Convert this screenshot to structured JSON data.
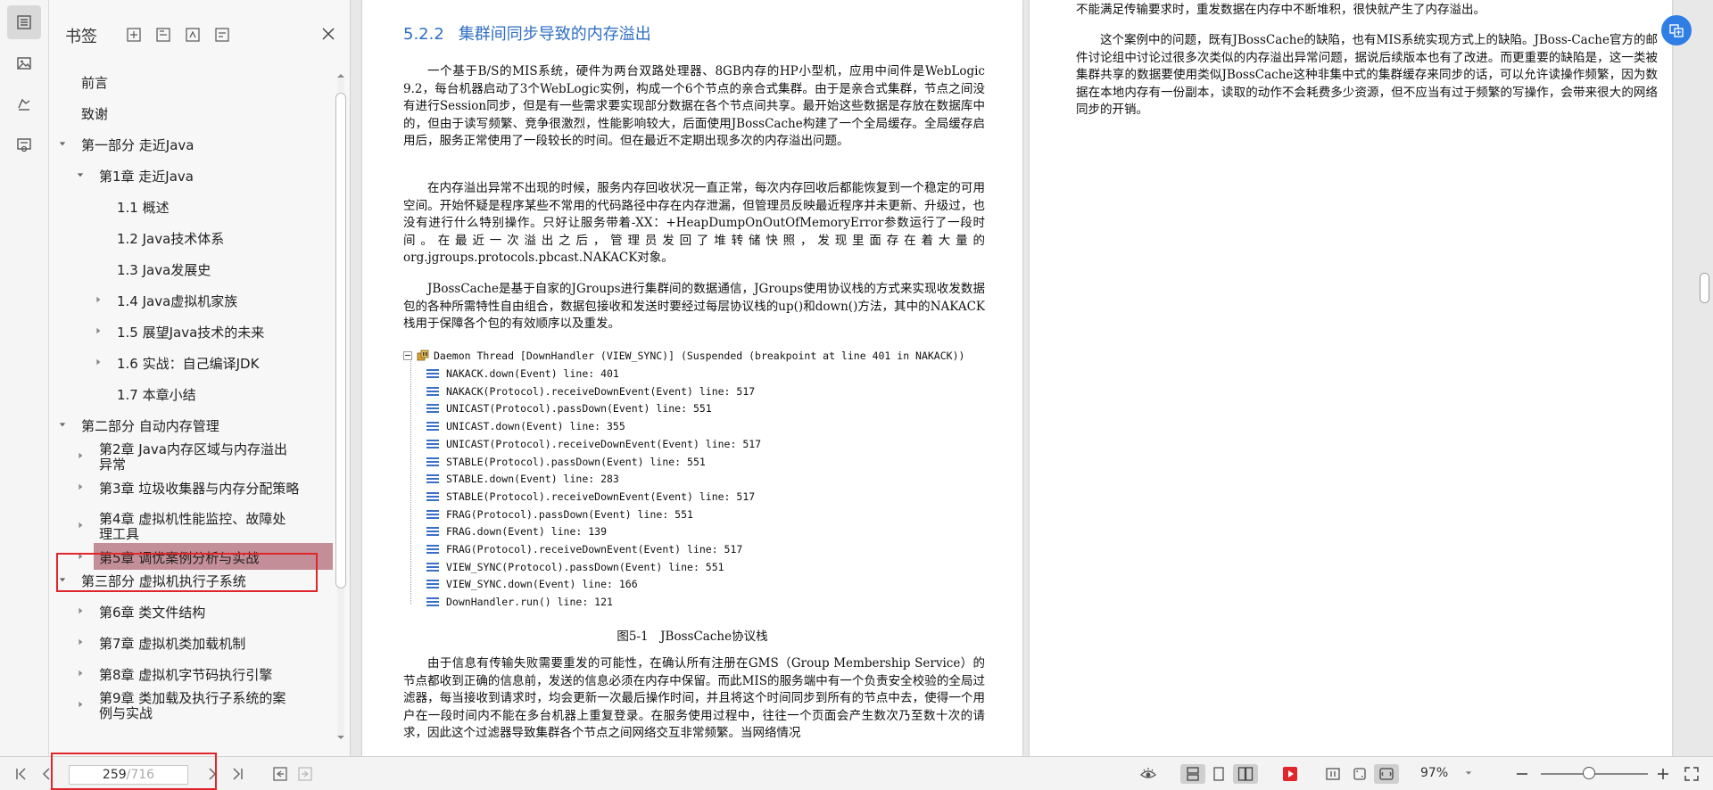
{
  "sidebar_strip": {
    "icons": [
      "bookmark-list-icon",
      "image-icon",
      "signature-icon",
      "certificate-icon"
    ]
  },
  "bookmark_panel": {
    "title": "书签",
    "toc": [
      {
        "label": "前言",
        "level": 0,
        "arrow": "none"
      },
      {
        "label": "致谢",
        "level": 0,
        "arrow": "none"
      },
      {
        "label": "第一部分 走近Java",
        "level": 0,
        "arrow": "expanded"
      },
      {
        "label": "第1章 走近Java",
        "level": 1,
        "arrow": "expanded"
      },
      {
        "label": "1.1 概述",
        "level": 2,
        "arrow": "none"
      },
      {
        "label": "1.2 Java技术体系",
        "level": 2,
        "arrow": "none"
      },
      {
        "label": "1.3 Java发展史",
        "level": 2,
        "arrow": "none"
      },
      {
        "label": "1.4 Java虚拟机家族",
        "level": 2,
        "arrow": "collapsed"
      },
      {
        "label": "1.5 展望Java技术的未来",
        "level": 2,
        "arrow": "collapsed"
      },
      {
        "label": "1.6 实战：自己编译JDK",
        "level": 2,
        "arrow": "collapsed"
      },
      {
        "label": "1.7 本章小结",
        "level": 2,
        "arrow": "none"
      },
      {
        "label": "第二部分 自动内存管理",
        "level": 0,
        "arrow": "expanded"
      },
      {
        "label": "第2章 Java内存区域与内存溢出异常",
        "level": 1,
        "arrow": "collapsed"
      },
      {
        "label": "第3章 垃圾收集器与内存分配策略",
        "level": 1,
        "arrow": "collapsed"
      },
      {
        "label": "第4章 虚拟机性能监控、故障处理工具",
        "level": 1,
        "arrow": "collapsed"
      },
      {
        "label": "第5章 调优案例分析与实战",
        "level": 1,
        "arrow": "collapsed",
        "selected": true
      },
      {
        "label": "第三部分 虚拟机执行子系统",
        "level": 0,
        "arrow": "expanded"
      },
      {
        "label": "第6章 类文件结构",
        "level": 1,
        "arrow": "collapsed"
      },
      {
        "label": "第7章 虚拟机类加载机制",
        "level": 1,
        "arrow": "collapsed"
      },
      {
        "label": "第8章 虚拟机字节码执行引擎",
        "level": 1,
        "arrow": "collapsed"
      },
      {
        "label": "第9章 类加载及执行子系统的案例与实战",
        "level": 1,
        "arrow": "collapsed"
      }
    ]
  },
  "document": {
    "section_number": "5.2.2",
    "section_title": "集群间同步导致的内存溢出",
    "paragraph_1": "一个基于B/S的MIS系统，硬件为两台双路处理器、8GB内存的HP小型机，应用中间件是WebLogic 9.2，每台机器启动了3个WebLogic实例，构成一个6个节点的亲合式集群。由于是亲合式集群，节点之间没有进行Session同步，但是有一些需求要实现部分数据在各个节点间共享。最开始这些数据是存放在数据库中的，但由于读写频繁、竞争很激烈，性能影响较大，后面使用JBossCache构建了一个全局缓存。全局缓存启用后，服务正常使用了一段较长的时间。但在最近不定期出现多次的内存溢出问题。",
    "paragraph_2": "在内存溢出异常不出现的时候，服务内存回收状况一直正常，每次内存回收后都能恢复到一个稳定的可用空间。开始怀疑是程序某些不常用的代码路径中存在内存泄漏，但管理员反映最近程序并未更新、升级过，也没有进行什么特别操作。只好让服务带着-XX：+HeapDumpOnOutOfMemoryError参数运行了一段时间。在最近一次溢出之后，管理员发回了堆转储快照，发现里面存在着大量的org.jgroups.protocols.pbcast.NAKACK对象。",
    "paragraph_3": "JBossCache是基于自家的JGroups进行集群间的数据通信，JGroups使用协议栈的方式来实现收发数据包的各种所需特性自由组合，数据包接收和发送时要经过每层协议栈的up()和down()方法，其中的NAKACK栈用于保障各个包的有效顺序以及重发。",
    "figure_thread": "Daemon Thread [DownHandler (VIEW_SYNC)] (Suspended (breakpoint at line 401 in NAKACK))",
    "figure_frames": [
      "NAKACK.down(Event) line: 401",
      "NAKACK(Protocol).receiveDownEvent(Event) line: 517",
      "UNICAST(Protocol).passDown(Event) line: 551",
      "UNICAST.down(Event) line: 355",
      "UNICAST(Protocol).receiveDownEvent(Event) line: 517",
      "STABLE(Protocol).passDown(Event) line: 551",
      "STABLE.down(Event) line: 283",
      "STABLE(Protocol).receiveDownEvent(Event) line: 517",
      "FRAG(Protocol).passDown(Event) line: 551",
      "FRAG.down(Event) line: 139",
      "FRAG(Protocol).receiveDownEvent(Event) line: 517",
      "VIEW_SYNC(Protocol).passDown(Event) line: 551",
      "VIEW_SYNC.down(Event) line: 166",
      "DownHandler.run() line: 121"
    ],
    "figure_caption": "图5-1　JBossCache协议栈",
    "paragraph_4": "由于信息有传输失败需要重发的可能性，在确认所有注册在GMS（Group Membership Service）的节点都收到正确的信息前，发送的信息必须在内存中保留。而此MIS的服务端中有一个负责安全校验的全局过滤器，每当接收到请求时，均会更新一次最后操作时间，并且将这个时间同步到所有的节点中去，使得一个用户在一段时间内不能在多台机器上重复登录。在服务使用过程中，往往一个页面会产生数次乃至数十次的请求，因此这个过滤器导致集群各个节点之间网络交互非常频繁。当网络情况",
    "right_paragraph_0": "不能满足传输要求时，重发数据在内存中不断堆积，很快就产生了内存溢出。",
    "right_paragraph_1": "这个案例中的问题，既有JBossCache的缺陷，也有MIS系统实现方式上的缺陷。JBoss-Cache官方的邮件讨论组中讨论过很多次类似的内存溢出异常问题，据说后续版本也有了改进。而更重要的缺陷是，这一类被集群共享的数据要使用类似JBossCache这种非集中式的集群缓存来同步的话，可以允许读操作频繁，因为数据在本地内存有一份副本，读取的动作不会耗费多少资源，但不应当有过于频繁的写操作，会带来很大的网络同步的开销。"
  },
  "bottom_bar": {
    "current_page": "259",
    "page_separator": "/",
    "total_pages": "716",
    "zoom": "97%"
  },
  "colors": {
    "heading_blue": "#2e6ec4",
    "selection_bg": "#c38e98",
    "highlight_red": "#e0262b",
    "frame_icon_blue": "#3a6fc8"
  }
}
